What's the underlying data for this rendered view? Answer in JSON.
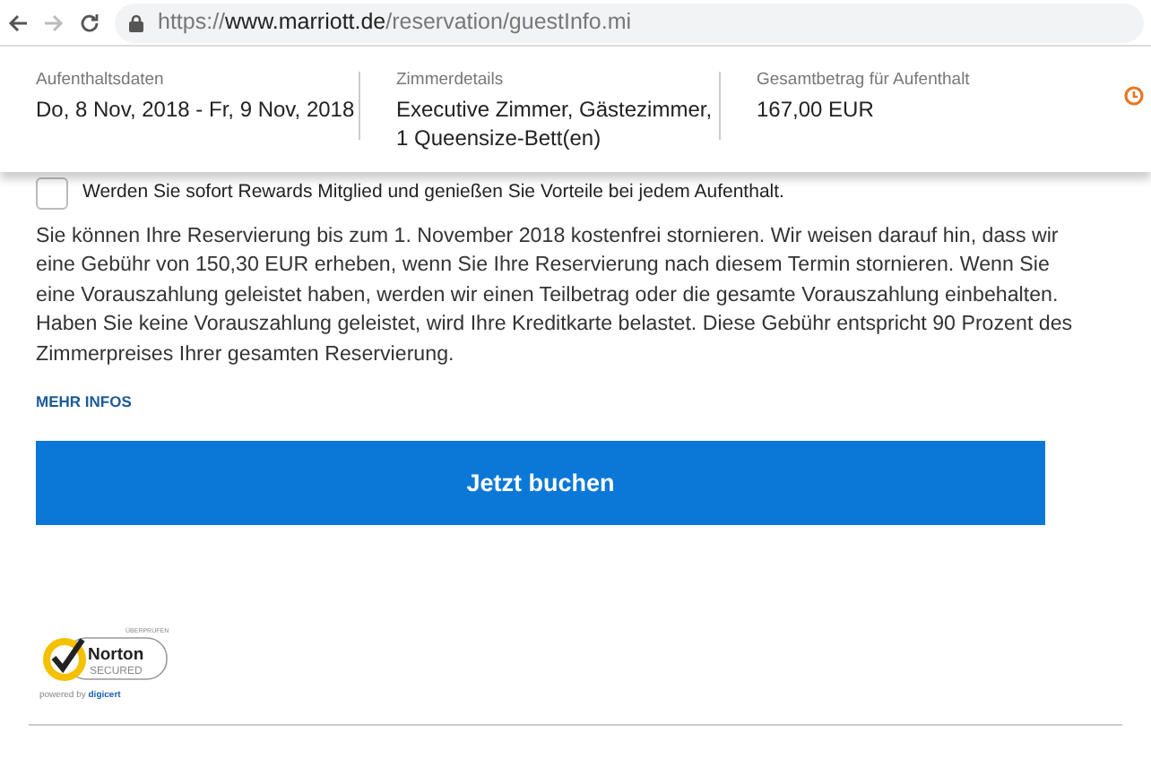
{
  "browser": {
    "url_scheme": "https://",
    "url_host": "www.marriott.de",
    "url_path": "/reservation/guestInfo.mi"
  },
  "summary": [
    {
      "label": "Aufenthaltsdaten",
      "value": "Do, 8 Nov, 2018 - Fr, 9 Nov, 2018"
    },
    {
      "label": "Zimmerdetails",
      "value": "Executive Zimmer, Gästezimmer, 1 Queensize-Bett(en)"
    },
    {
      "label": "Gesamtbetrag für Aufenthalt",
      "value": "167,00 EUR"
    }
  ],
  "rewards": {
    "label": "Werden Sie sofort Rewards Mitglied und genießen Sie Vorteile bei jedem Aufenthalt.",
    "checked": false
  },
  "policy": "Sie können Ihre Reservierung bis zum 1. November 2018 kostenfrei stornieren. Wir weisen darauf hin, dass wir eine Gebühr von 150,30 EUR erheben, wenn Sie Ihre Reservierung nach diesem Termin stornieren. Wenn Sie eine Vorauszahlung geleistet haben, werden wir einen Teilbetrag oder die gesamte Vorauszahlung einbehalten. Haben Sie keine Vorauszahlung geleistet, wird Ihre Kreditkarte belastet. Diese Gebühr entspricht 90 Prozent des Zimmerpreises Ihrer gesamten Reservierung.",
  "more_link": "MEHR INFOS",
  "book_button": "Jetzt buchen",
  "seal": {
    "top": "ÜBERPRÜFEN",
    "brand": "Norton",
    "sub": "SECURED",
    "powered": "powered by",
    "vendor": "digicert"
  }
}
